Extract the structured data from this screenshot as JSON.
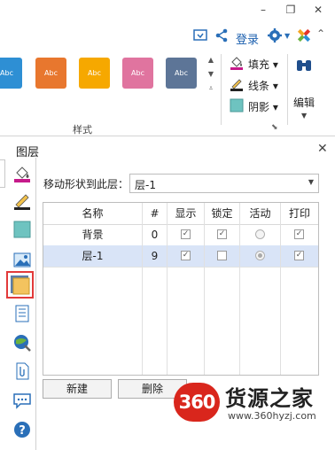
{
  "window": {
    "controls": [
      "–",
      "❐",
      "✕"
    ]
  },
  "quickbar": {
    "login_label": "登录"
  },
  "ribbon": {
    "styles": [
      {
        "label": "Abc",
        "color": "#2e8fd4"
      },
      {
        "label": "Abc",
        "color": "#e8772e"
      },
      {
        "label": "Abc",
        "color": "#f6a800"
      },
      {
        "label": "Abc",
        "color": "#e0749f"
      },
      {
        "label": "Abc",
        "color": "#5d7597"
      }
    ],
    "group_label": "样式",
    "fill_label": "填充",
    "line_label": "线条",
    "shadow_label": "阴影",
    "edit_label": "编辑"
  },
  "panel": {
    "title": "图层",
    "move_label": "移动形状到此层：",
    "move_value": "层-1",
    "columns": [
      "名称",
      "#",
      "显示",
      "锁定",
      "活动",
      "打印"
    ],
    "rows": [
      {
        "name": "背景",
        "num": "0",
        "show": true,
        "lock": true,
        "active": false,
        "print": true,
        "selected": false
      },
      {
        "name": "层-1",
        "num": "9",
        "show": true,
        "lock": false,
        "active": true,
        "print": true,
        "selected": true
      }
    ],
    "new_button": "新建",
    "delete_button": "删除"
  },
  "watermark": {
    "badge": "360",
    "title": "货源之家",
    "url": "www.360hyzj.com"
  }
}
